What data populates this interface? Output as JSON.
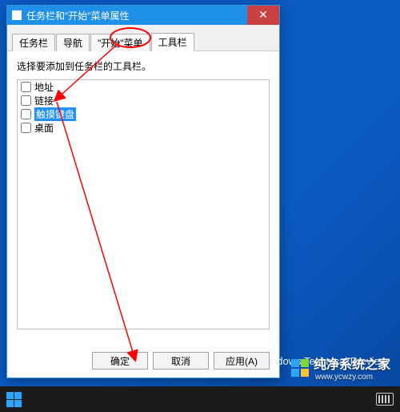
{
  "window": {
    "title": "任务栏和\"开始\"菜单属性",
    "close_glyph": "✕"
  },
  "tabs": [
    {
      "label": "任务栏",
      "active": false
    },
    {
      "label": "导航",
      "active": false
    },
    {
      "label": "\"开始\"菜单",
      "active": false
    },
    {
      "label": "工具栏",
      "active": true
    }
  ],
  "body": {
    "instruction": "选择要添加到任务栏的工具栏。",
    "toolbars": [
      {
        "label": "地址",
        "checked": false,
        "selected": false
      },
      {
        "label": "链接",
        "checked": false,
        "selected": false
      },
      {
        "label": "触摸键盘",
        "checked": false,
        "selected": true
      },
      {
        "label": "桌面",
        "checked": false,
        "selected": false
      }
    ]
  },
  "buttons": {
    "ok": "确定",
    "cancel": "取消",
    "apply": "应用(A)"
  },
  "desktop": {
    "watermark": "Windows Technical Preview",
    "brand_main": "纯净系统之家",
    "brand_sub": "www.ycwzy.com"
  }
}
